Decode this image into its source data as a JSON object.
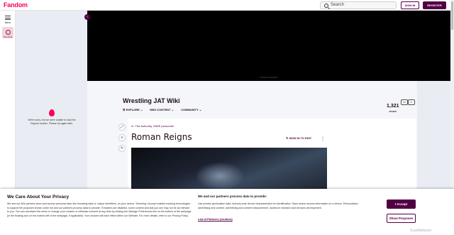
{
  "topbar": {
    "logo": "Fandom",
    "search_placeholder": "Search",
    "sign_in": "SIGN IN",
    "register": "REGISTER"
  },
  "rail": {
    "menu_label": "Menu",
    "wiki_label": "Wrestling"
  },
  "video": {
    "label": "ADVERTISEMENT"
  },
  "explore": {
    "message": "We're sorry, but we were unable to load the Explore section. Please try again later."
  },
  "wiki": {
    "title": "Wrestling JAT Wiki",
    "nav": [
      "EXPLORE",
      "WIKI CONTENT",
      "COMMUNITY"
    ],
    "pages_count": "1,321",
    "pages_label": "PAGES"
  },
  "article": {
    "crumb_prefix": "In:",
    "crumb_links": [
      "The Authority",
      "WWE personnel"
    ],
    "title": "Roman Reigns",
    "edit_label": "SIGN IN TO EDIT"
  },
  "consent": {
    "title": "We Care About Your Privacy",
    "body": "We and our 804 partners store and access personal data, like browsing data or unique identifiers, on your device. Selecting I Accept enables tracking technologies to support the purposes shown under we and our partners process data to provide. If trackers are disabled, some content and ads you see may not be as relevant to you. You can resurface this menu to change your choices or withdraw consent at any time by clicking the Manage Preferences link on the bottom of the webpage [or the floating icon on the bottom-left of the webpage, if applicable]. Your choices will have effect within our Website. For more details, refer to our Privacy Policy.",
    "title2": "We and our partners process data to provide:",
    "body2": "Use precise geolocation data. Actively scan device characteristics for identification. Store and/or access information on a device. Personalised advertising and content, advertising and content measurement, audience research and services development.",
    "partners_link": "List of Partners (vendors)",
    "accept": "I Accept",
    "show_purposes": "Show Purposes",
    "watermark": "ScanMalware"
  },
  "colors": {
    "brand": "#fa005a",
    "primary": "#520044"
  }
}
